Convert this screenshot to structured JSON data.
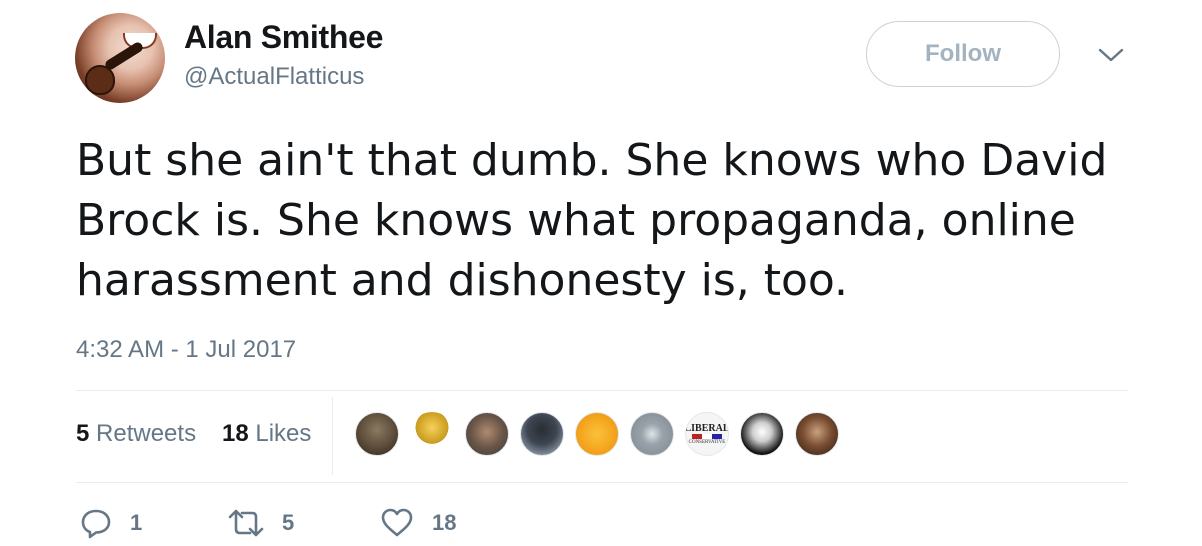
{
  "tweet": {
    "author": {
      "name": "Alan Smithee",
      "handle": "@ActualFlatticus",
      "avatar_icon": "pipe-mouth-avatar"
    },
    "follow_label": "Follow",
    "text": "But she ain't that dumb.  She knows who David Brock is.  She knows what propaganda, online harassment and dishonesty is, too.",
    "timestamp": "4:32 AM - 1 Jul 2017",
    "stats": {
      "retweets_count": "5",
      "retweets_label": "Retweets",
      "likes_count": "18",
      "likes_label": "Likes"
    },
    "likers": [
      {
        "icon": "moai-statue-avatar"
      },
      {
        "icon": "golden-trophy-avatar"
      },
      {
        "icon": "bearded-man-avatar"
      },
      {
        "icon": "dark-figure-avatar"
      },
      {
        "icon": "yellow-cartoon-avatar"
      },
      {
        "icon": "white-dog-avatar"
      },
      {
        "icon": "liberal-conservative-sign-avatar",
        "text_top": "LIBERAL",
        "text_bottom": "CONSERVATIVE"
      },
      {
        "icon": "black-white-face-avatar"
      },
      {
        "icon": "dark-portrait-avatar"
      }
    ],
    "actions": {
      "reply_count": "1",
      "retweet_count": "5",
      "like_count": "18"
    }
  },
  "colors": {
    "text": "#14171a",
    "secondary": "#657786",
    "border": "#e6ecf0",
    "follow_text": "#a3b3bf"
  }
}
